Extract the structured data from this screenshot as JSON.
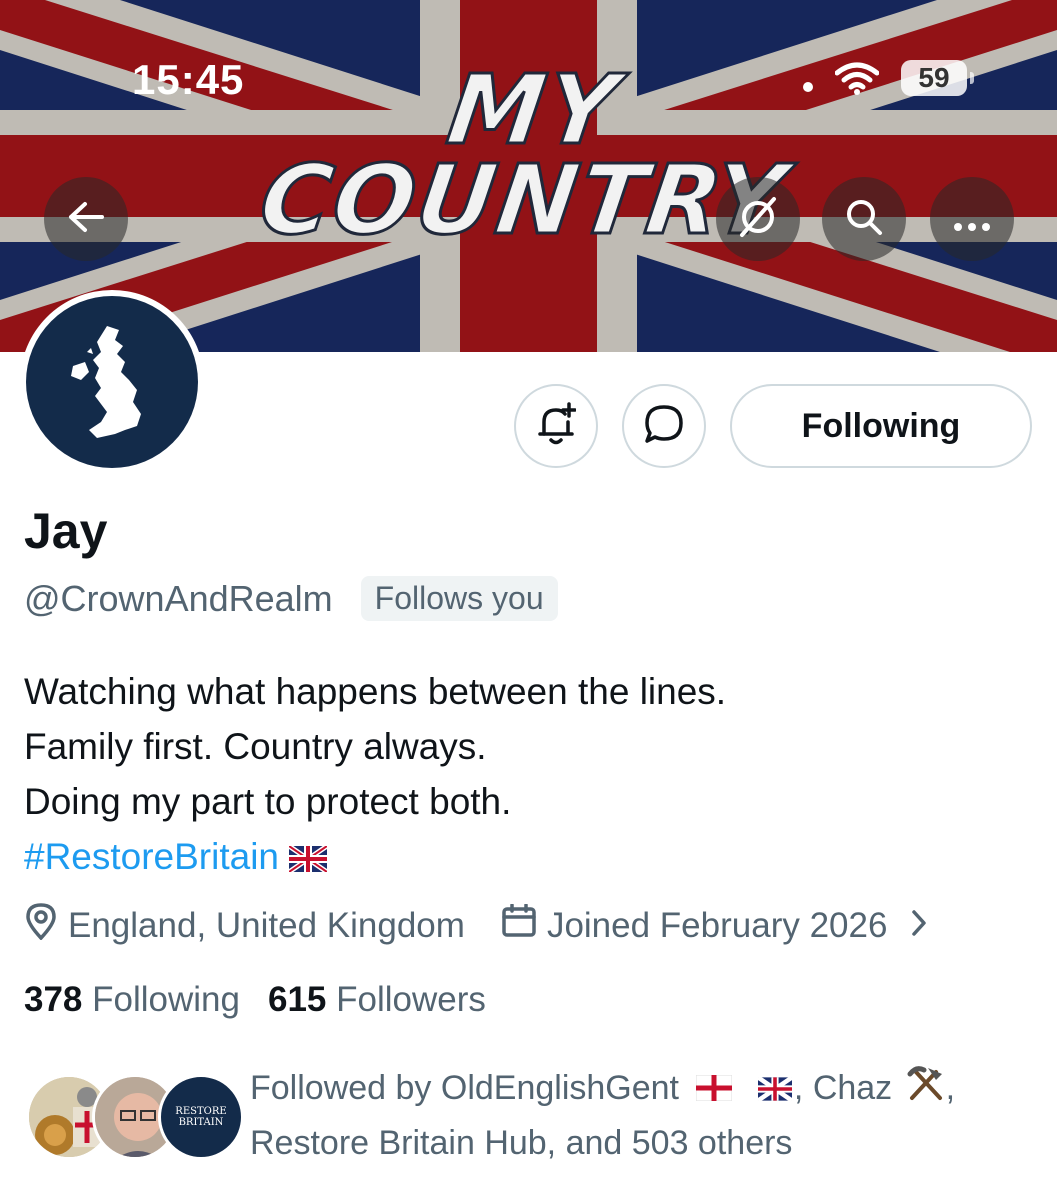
{
  "status_bar": {
    "time": "15:45",
    "battery": "59"
  },
  "banner": {
    "line1": "MY",
    "line2": "COUNTRY"
  },
  "icons": {
    "back": "arrow-left-icon",
    "grok": "grok-icon",
    "search": "search-icon",
    "more": "more-icon",
    "notify": "bell-plus-icon",
    "message": "message-icon",
    "location": "location-pin-icon",
    "calendar": "calendar-icon",
    "chevron": "chevron-right-icon"
  },
  "actions": {
    "follow_label": "Following"
  },
  "profile": {
    "name": "Jay",
    "handle": "@CrownAndRealm",
    "follows_you": "Follows you",
    "bio": [
      "Watching what happens between the lines.",
      "Family first. Country always.",
      "Doing my part to protect both."
    ],
    "hashtag": "#RestoreBritain",
    "location": "England, United Kingdom",
    "joined": "Joined February 2026"
  },
  "stats": {
    "following_count": "378",
    "following_label": "Following",
    "followers_count": "615",
    "followers_label": "Followers"
  },
  "followed_by": {
    "prefix": "Followed by OldEnglishGent",
    "name2": ", Chaz",
    "line2": "Restore Britain Hub, and 503 others",
    "avatar3_text": "RESTORE BRITAIN"
  },
  "colors": {
    "accent": "#1d9bf0",
    "secondary_text": "#536471",
    "primary_text": "#0f1419",
    "border": "#cfd9de",
    "avatar_navy": "#132b4a"
  }
}
